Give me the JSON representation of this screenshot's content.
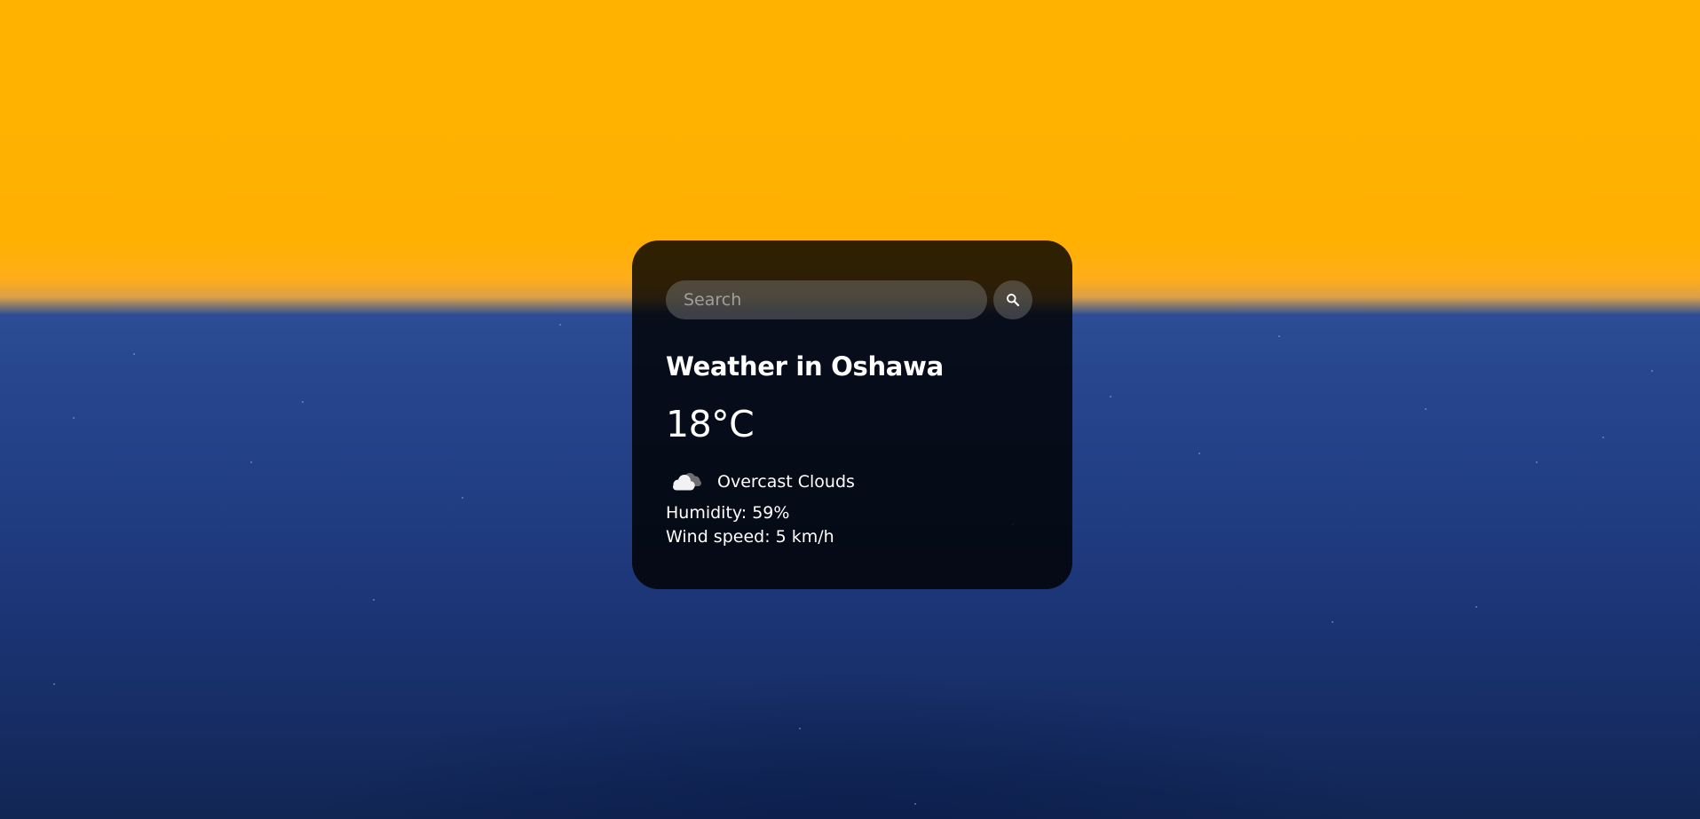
{
  "search": {
    "placeholder": "Search",
    "button_icon": "search-icon"
  },
  "weather": {
    "city_heading": "Weather in Oshawa",
    "temperature": "18°C",
    "icon": "overcast-clouds-icon",
    "description": "Overcast Clouds",
    "humidity": "Humidity: 59%",
    "wind_speed": "Wind speed: 5 km/h"
  },
  "colors": {
    "sky": "#ffb300",
    "water": "#27468e",
    "card_background": "rgba(0,0,0,0.82)"
  }
}
